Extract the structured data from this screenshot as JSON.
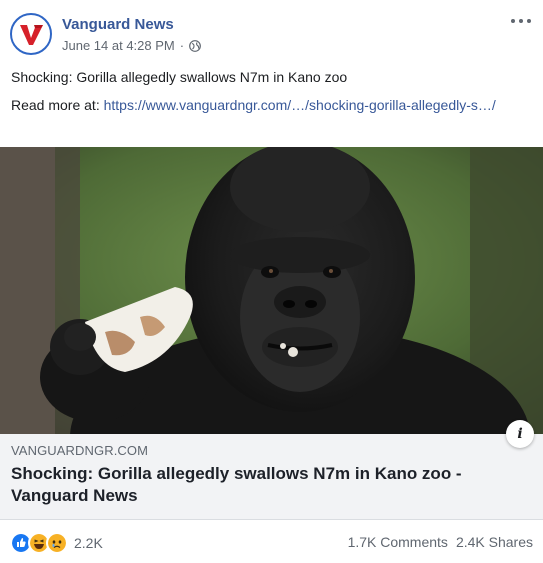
{
  "header": {
    "page_name": "Vanguard News",
    "timestamp": "June 14 at 4:28 PM",
    "separator": "·",
    "avatar_letter": "V"
  },
  "post": {
    "text": "Shocking: Gorilla allegedly swallows N7m in Kano zoo",
    "read_more_prefix": "Read more at: ",
    "link": "https://www.vanguardngr.com/…/shocking-gorilla-allegedly-s…/"
  },
  "image": {
    "icon": "gorilla-photo"
  },
  "card": {
    "domain": "VANGUARDNGR.COM",
    "title": "Shocking: Gorilla allegedly swallows N7m in Kano zoo - Vanguard News",
    "info_glyph": "i"
  },
  "footer": {
    "reaction_count": "2.2K",
    "comments": "1.7K Comments",
    "shares": "2.4K Shares"
  },
  "colors": {
    "brand_blue": "#385898",
    "avatar_red": "#d6212a",
    "card_bg": "#f2f3f5"
  }
}
